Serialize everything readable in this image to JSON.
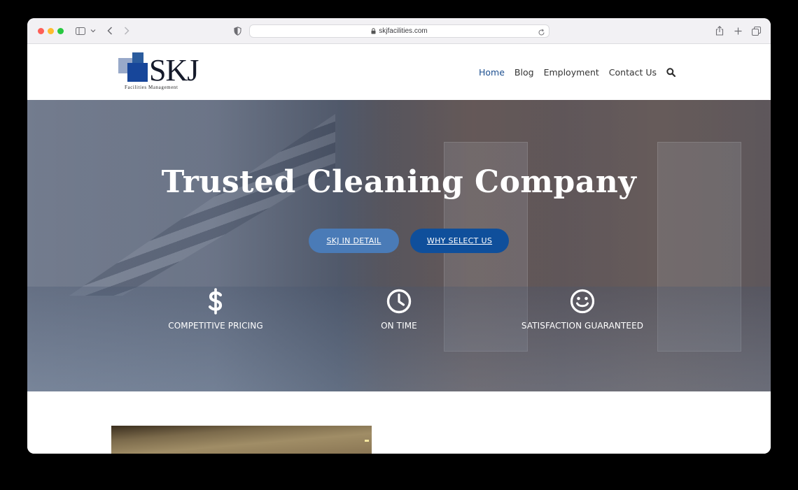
{
  "browser": {
    "url": "skjfacilities.com"
  },
  "header": {
    "logo": {
      "letters": "SKJ",
      "tagline": "Facilities Management"
    },
    "nav": [
      {
        "label": "Home",
        "active": true
      },
      {
        "label": "Blog",
        "active": false
      },
      {
        "label": "Employment",
        "active": false
      },
      {
        "label": "Contact Us",
        "active": false
      }
    ],
    "search_icon": "search-icon"
  },
  "hero": {
    "title": "Trusted Cleaning Company",
    "buttons": {
      "detail": "SKJ IN DETAIL",
      "why": "WHY SELECT US"
    },
    "features": [
      {
        "icon": "dollar-icon",
        "label": "COMPETITIVE PRICING"
      },
      {
        "icon": "clock-icon",
        "label": "ON TIME"
      },
      {
        "icon": "smiley-icon",
        "label": "SATISFACTION GUARANTEED"
      }
    ]
  },
  "colors": {
    "nav_active": "#1b4e8f",
    "button_primary": "#0f4f9b",
    "button_secondary": "#4a7bb7",
    "logo_blue": "#17469a"
  }
}
